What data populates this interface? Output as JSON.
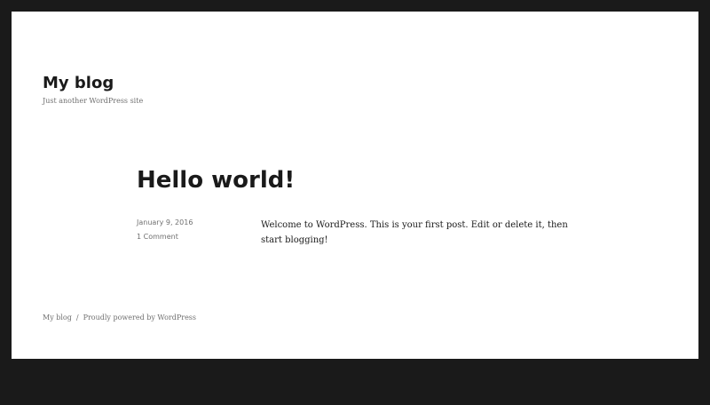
{
  "site": {
    "title": "My blog",
    "description": "Just another WordPress site"
  },
  "post": {
    "title": "Hello world!",
    "date": "January 9, 2016",
    "comments": "1 Comment",
    "content": "Welcome to WordPress. This is your first post. Edit or delete it, then start blogging!"
  },
  "footer": {
    "site_link": "My blog",
    "separator": "/",
    "powered_by": "Proudly powered by WordPress"
  },
  "colors": {
    "frame": "#1a1a1a",
    "page": "#ffffff",
    "text": "#1a1a1a",
    "muted": "#707070"
  }
}
